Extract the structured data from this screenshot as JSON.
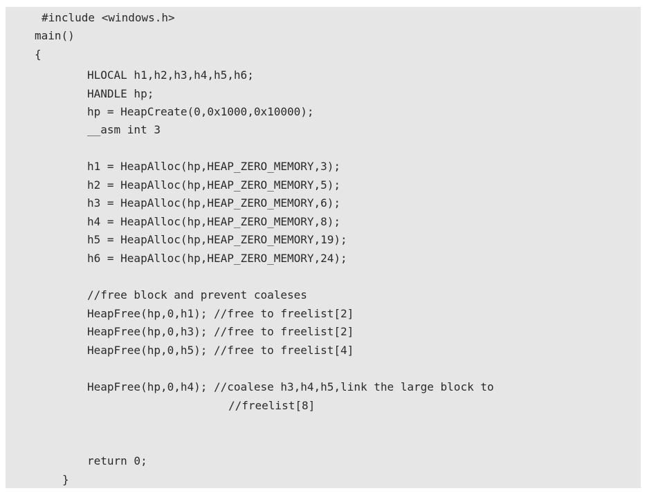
{
  "document": {
    "code_lines": [
      "#include <windows.h>",
      "main()",
      "{",
      "HLOCAL h1,h2,h3,h4,h5,h6;",
      "HANDLE hp;",
      "hp = HeapCreate(0,0x1000,0x10000);",
      "__asm int 3",
      "h1 = HeapAlloc(hp,HEAP_ZERO_MEMORY,3);",
      "h2 = HeapAlloc(hp,HEAP_ZERO_MEMORY,5);",
      "h3 = HeapAlloc(hp,HEAP_ZERO_MEMORY,6);",
      "h4 = HeapAlloc(hp,HEAP_ZERO_MEMORY,8);",
      "h5 = HeapAlloc(hp,HEAP_ZERO_MEMORY,19);",
      "h6 = HeapAlloc(hp,HEAP_ZERO_MEMORY,24);",
      "//free block and prevent coaleses",
      "HeapFree(hp,0,h1); //free to freelist[2]",
      "HeapFree(hp,0,h3); //free to freelist[2]",
      "HeapFree(hp,0,h5); //free to freelist[4]",
      "HeapFree(hp,0,h4); //coalese h3,h4,h5,link the large block to",
      "//freelist[8]",
      "return 0;",
      "}"
    ]
  }
}
